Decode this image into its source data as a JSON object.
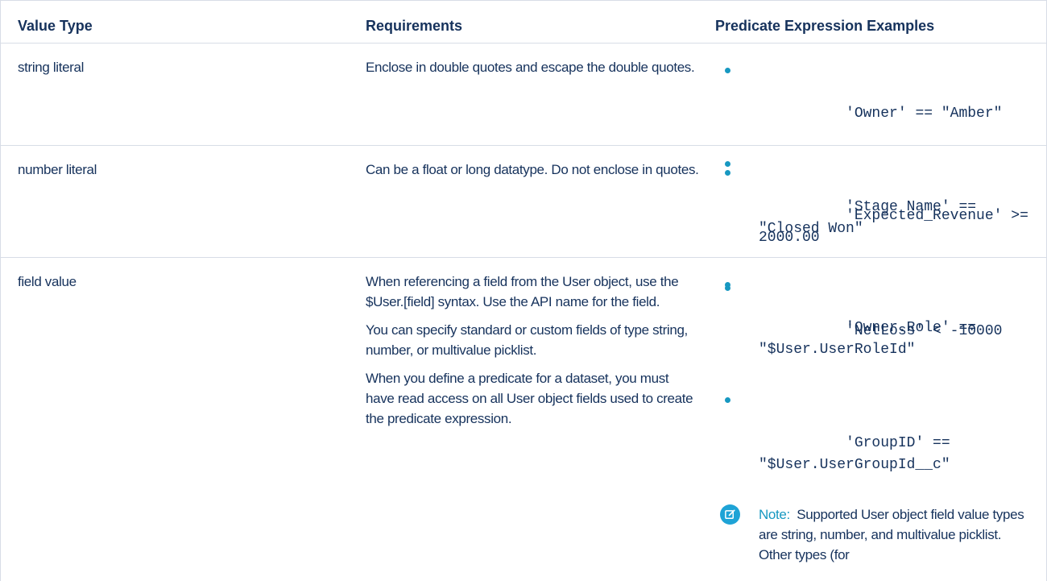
{
  "headers": {
    "value_type": "Value Type",
    "requirements": "Requirements",
    "examples": "Predicate Expression Examples"
  },
  "rows": [
    {
      "value_type": "string literal",
      "requirements": [
        "Enclose in double quotes and escape the double quotes."
      ],
      "examples": [
        "'Owner' == \"Amber\"",
        "'Stage Name' == \"Closed Won\""
      ]
    },
    {
      "value_type": "number literal",
      "requirements": [
        "Can be a float or long datatype. Do not enclose in quotes."
      ],
      "examples": [
        "'Expected_Revenue' >= 2000.00",
        "'NetLoss' < -10000"
      ]
    },
    {
      "value_type": "field value",
      "requirements": [
        "When referencing a field from the User object, use the $User.[field] syntax. Use the API name for the field.",
        "You can specify standard or custom fields of type string, number, or multivalue picklist.",
        "When you define a predicate for a dataset, you must have read access on all User object fields used to create the predicate expression."
      ],
      "examples": [
        "'Owner.Role' == \"$User.UserRoleId\"",
        "'GroupID' == \"$User.UserGroupId__c\""
      ],
      "note": {
        "label": "Note:",
        "text": "Supported User object field value types are string, number, and multivalue picklist. Other types (for",
        "icon": "edit-note-icon"
      }
    }
  ],
  "colors": {
    "text": "#16325c",
    "accent": "#1798c1",
    "border": "#d8dde6"
  }
}
